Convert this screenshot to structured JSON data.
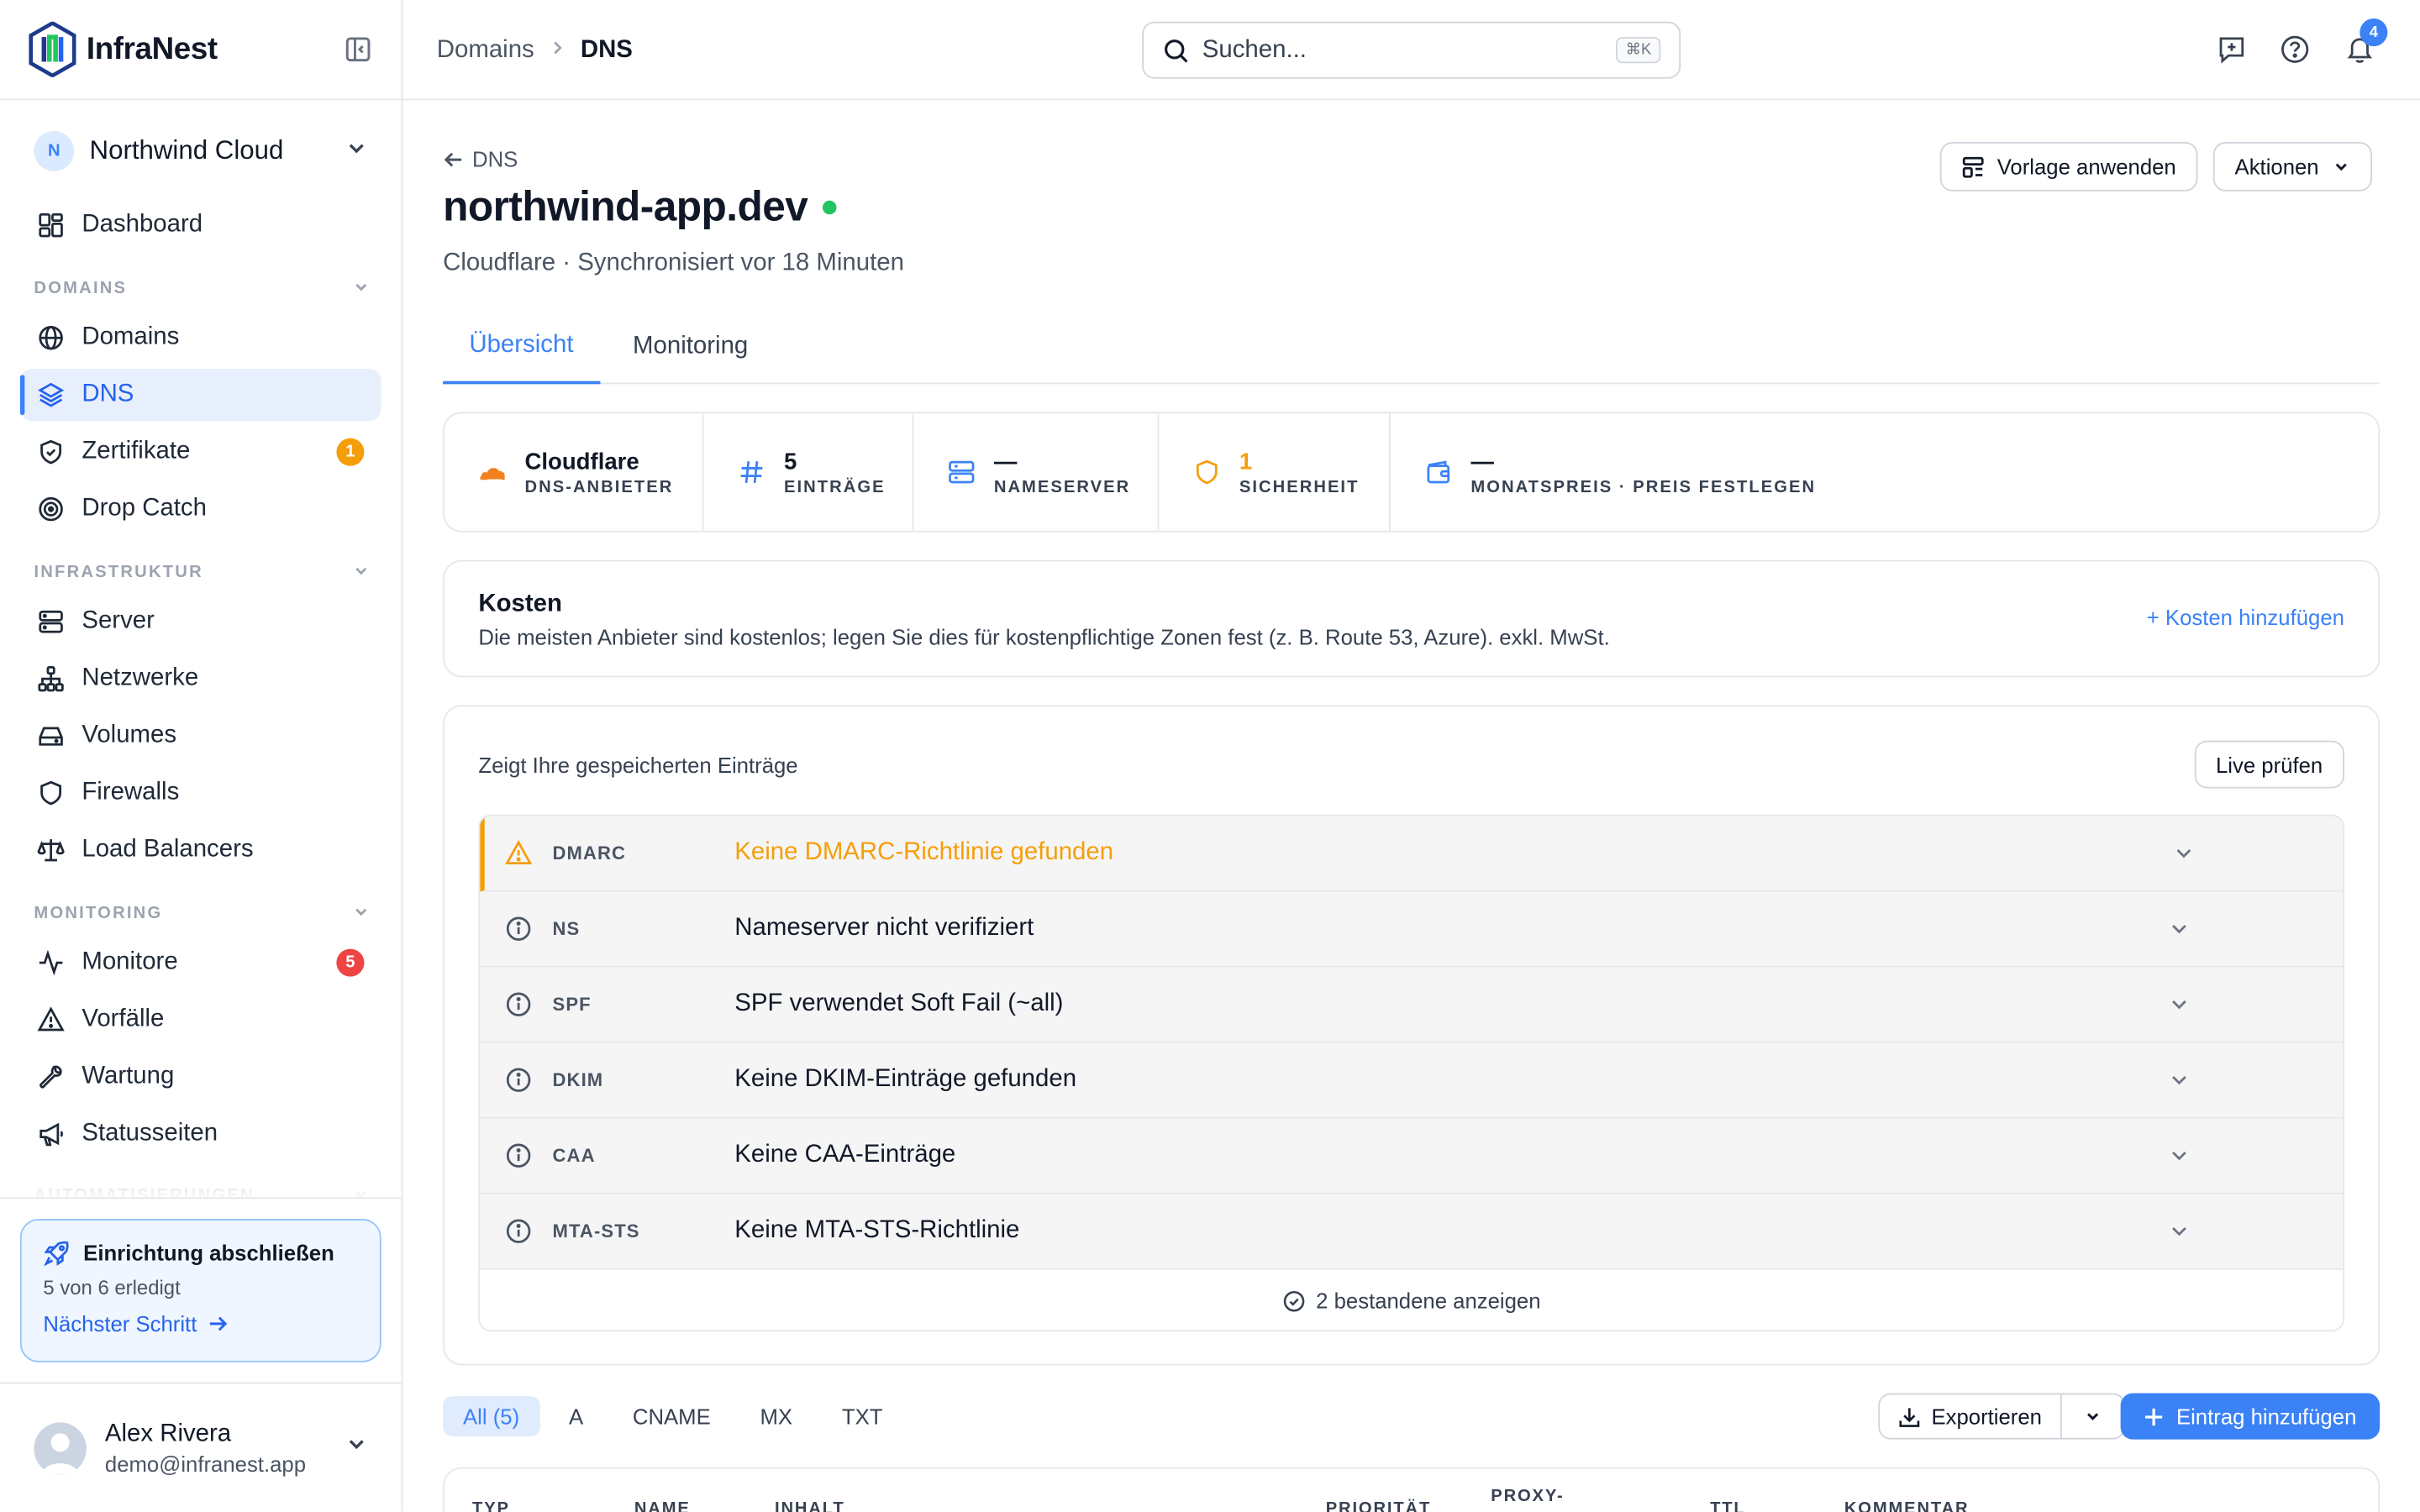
{
  "app": {
    "name": "InfraNest"
  },
  "org": {
    "initial": "N",
    "name": "Northwind Cloud"
  },
  "sidebar": {
    "dashboard": "Dashboard",
    "sections": {
      "domains": "DOMAINS",
      "infra": "INFRASTRUKTUR",
      "monitoring": "MONITORING",
      "automation": "AUTOMATISIERUNGEN"
    },
    "items": {
      "domains": "Domains",
      "dns": "DNS",
      "zertifikate": "Zertifikate",
      "dropcatch": "Drop Catch",
      "server": "Server",
      "netzwerke": "Netzwerke",
      "volumes": "Volumes",
      "firewalls": "Firewalls",
      "loadbalancers": "Load Balancers",
      "monitore": "Monitore",
      "vorfaelle": "Vorfälle",
      "wartung": "Wartung",
      "statusseiten": "Statusseiten"
    },
    "badges": {
      "zertifikate": "1",
      "monitore": "5"
    },
    "setup": {
      "title": "Einrichtung abschließen",
      "progress": "5 von 6 erledigt",
      "next": "Nächster Schritt"
    },
    "user": {
      "name": "Alex Rivera",
      "email": "demo@infranest.app"
    }
  },
  "topbar": {
    "breadcrumb": [
      "Domains",
      "DNS"
    ],
    "search_placeholder": "Suchen...",
    "search_shortcut": "⌘K",
    "notification_count": "4"
  },
  "page": {
    "back_label": "DNS",
    "title": "northwind-app.dev",
    "subtitle": "Cloudflare · Synchronisiert vor 18 Minuten",
    "template_button": "Vorlage anwenden",
    "actions_button": "Aktionen",
    "tabs": [
      "Übersicht",
      "Monitoring"
    ],
    "stats": [
      {
        "value": "Cloudflare",
        "label": "DNS-ANBIETER"
      },
      {
        "value": "5",
        "label": "EINTRÄGE"
      },
      {
        "value": "—",
        "label": "NAMESERVER"
      },
      {
        "value": "1",
        "label": "SICHERHEIT"
      },
      {
        "value": "—",
        "label": "MONATSPREIS · PREIS FESTLEGEN"
      }
    ],
    "costs": {
      "title": "Kosten",
      "description": "Die meisten Anbieter sind kostenlos; legen Sie dies für kostenpflichtige Zonen fest (z. B. Route 53, Azure). exkl. MwSt.",
      "add_link": "+ Kosten hinzufügen"
    },
    "checks": {
      "heading": "Zeigt Ihre gespeicherten Einträge",
      "live_button": "Live prüfen",
      "rows": [
        {
          "code": "DMARC",
          "message": "Keine DMARC-Richtlinie gefunden",
          "level": "warning"
        },
        {
          "code": "NS",
          "message": "Nameserver nicht verifiziert",
          "level": "info"
        },
        {
          "code": "SPF",
          "message": "SPF verwendet Soft Fail (~all)",
          "level": "info"
        },
        {
          "code": "DKIM",
          "message": "Keine DKIM-Einträge gefunden",
          "level": "info"
        },
        {
          "code": "CAA",
          "message": "Keine CAA-Einträge",
          "level": "info"
        },
        {
          "code": "MTA-STS",
          "message": "Keine MTA-STS-Richtlinie",
          "level": "info"
        }
      ],
      "passed_label": "2 bestandene anzeigen"
    },
    "filters": [
      "All (5)",
      "A",
      "CNAME",
      "MX",
      "TXT"
    ],
    "export_button": "Exportieren",
    "add_button": "Eintrag hinzufügen",
    "table_headers": [
      "TYP",
      "NAME",
      "INHALT",
      "PRIORITÄT",
      "PROXY-",
      "TTL",
      "KOMMENTAR"
    ]
  },
  "colors": {
    "accent": "#3b82f6",
    "warning": "#f59e0b",
    "danger": "#ef4444",
    "success": "#22c55e"
  }
}
